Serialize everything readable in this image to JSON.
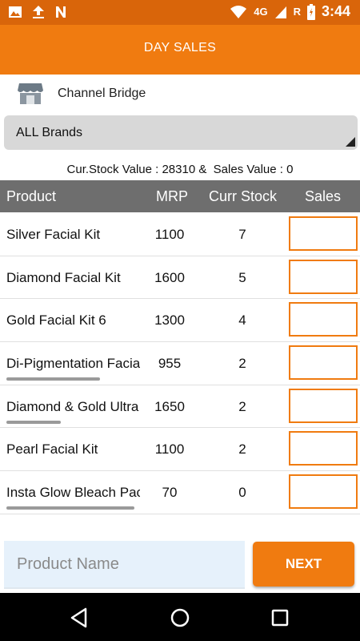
{
  "status_bar": {
    "network": "4G",
    "roaming": "R",
    "time": "3:44"
  },
  "app_bar": {
    "title": "DAY SALES"
  },
  "channel": {
    "name": "Channel Bridge",
    "icon": "storefront-icon"
  },
  "brand_filter": {
    "selected": "ALL Brands"
  },
  "summary": {
    "text": "Cur.Stock Value : 28310 &  Sales Value : 0"
  },
  "table": {
    "headers": {
      "product": "Product",
      "mrp": "MRP",
      "stock": "Curr Stock",
      "sales": "Sales"
    },
    "rows": [
      {
        "product": "Silver Facial Kit",
        "mrp": "1100",
        "stock": "7",
        "sales": ""
      },
      {
        "product": "Diamond Facial Kit",
        "mrp": "1600",
        "stock": "5",
        "sales": ""
      },
      {
        "product": "Gold Facial Kit 6",
        "mrp": "1300",
        "stock": "4",
        "sales": ""
      },
      {
        "product": "Di-Pigmentation Facial Kit",
        "mrp": "955",
        "stock": "2",
        "sales": ""
      },
      {
        "product": "Diamond & Gold Ultra",
        "mrp": "1650",
        "stock": "2",
        "sales": ""
      },
      {
        "product": "Pearl Facial Kit",
        "mrp": "1100",
        "stock": "2",
        "sales": ""
      },
      {
        "product": "Insta Glow Bleach Pack",
        "mrp": "70",
        "stock": "0",
        "sales": ""
      }
    ]
  },
  "search": {
    "placeholder": "Product Name",
    "value": ""
  },
  "next_button": {
    "label": "NEXT"
  },
  "colors": {
    "accent": "#f07b10",
    "status_bar": "#d9650a",
    "header_gray": "#6e6e6e"
  }
}
